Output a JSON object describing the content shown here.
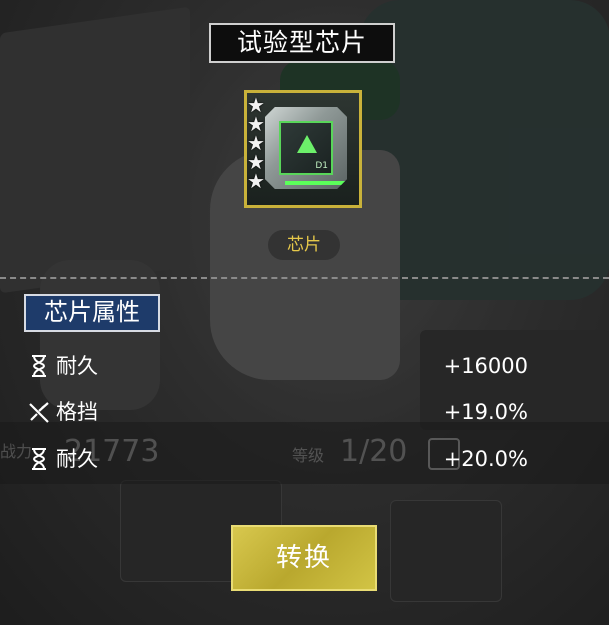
{
  "dialog": {
    "title": "试验型芯片",
    "item": {
      "icon": "chip-icon",
      "code": "D1",
      "stars": 5,
      "tag_label": "芯片"
    },
    "section_title": "芯片属性",
    "attributes": [
      {
        "icon": "hourglass-icon",
        "name": "耐久",
        "value": "+16000"
      },
      {
        "icon": "block-icon",
        "name": "格挡",
        "value": "+19.0%"
      },
      {
        "icon": "hourglass-icon",
        "name": "耐久",
        "value": "+20.0%"
      }
    ],
    "convert_label": "转换"
  },
  "background": {
    "power_label": "战力",
    "power_value": "21773",
    "level_label": "等级",
    "level_value": "1/20"
  },
  "colors": {
    "accent_gold": "#c9b23a",
    "section_blue": "#1e3b6a",
    "chip_green": "#59d65a"
  }
}
